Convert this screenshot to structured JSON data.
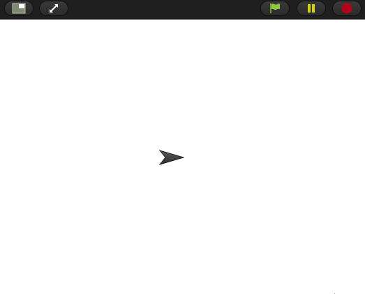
{
  "toolbar": {
    "buttons": [
      {
        "name": "stage-size-button",
        "icon": "small-stage-icon"
      },
      {
        "name": "fullscreen-button",
        "icon": "expand-arrows-icon"
      },
      {
        "name": "green-flag-button",
        "icon": "green-flag-icon",
        "color": "#8ec63f"
      },
      {
        "name": "pause-button",
        "icon": "pause-icon",
        "color": "#d7d400"
      },
      {
        "name": "stop-button",
        "icon": "stop-icon",
        "color": "#b5001c"
      }
    ],
    "background": "#1e1e1e"
  },
  "stage": {
    "background": "#ffffff",
    "sprite": {
      "icon": "arrow-sprite-icon",
      "color": "#3a3a3a"
    }
  }
}
